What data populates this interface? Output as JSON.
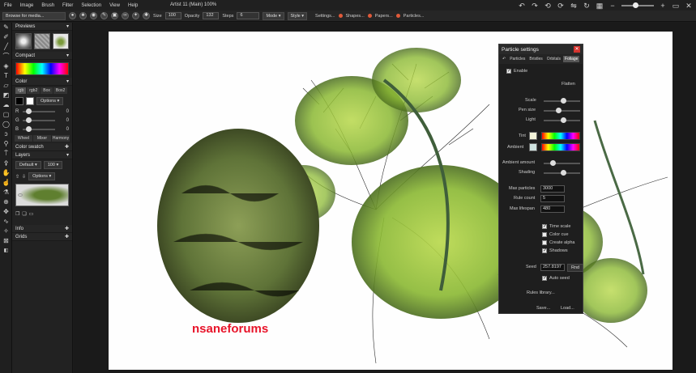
{
  "menu": [
    "File",
    "Image",
    "Brush",
    "Filter",
    "Selection",
    "View",
    "Help"
  ],
  "app_title": "Artist 11 (Main)",
  "zoom": "100%",
  "toolbar": {
    "browse": "Browse for media...",
    "size_label": "Size",
    "size_value": "100",
    "opacity_label": "Opacity",
    "opacity_value": "132",
    "steps_label": "Steps",
    "steps_value": "6",
    "mode_label": "Mode",
    "style_label": "Style",
    "settings_label": "Settings...",
    "shapes_label": "Shapes...",
    "papers_label": "Papers...",
    "particles_label": "Particles..."
  },
  "sidebar": {
    "previews_title": "Previews",
    "compact_title": "Compact",
    "color_title": "Color",
    "color_tabs": [
      "rgb",
      "rgb2",
      "Box",
      "Box2"
    ],
    "options_label": "Options",
    "channels": [
      {
        "label": "R",
        "value": "0"
      },
      {
        "label": "G",
        "value": "0"
      },
      {
        "label": "B",
        "value": "0"
      }
    ],
    "wheel_tabs": [
      "Wheel",
      "Mixer",
      "Harmony"
    ],
    "color_swatch_title": "Color swatch",
    "layers_title": "Layers",
    "layer_blend": "Default",
    "layer_opacity": "100",
    "layers_options": "Options",
    "info_title": "Info",
    "grids_title": "Grids"
  },
  "watermark": "nsaneforums",
  "particle_panel": {
    "title": "Particle settings",
    "tabs": [
      "Particles",
      "Bristles",
      "Orbitals",
      "Foliage"
    ],
    "enable_label": "Enable",
    "flatten_label": "Flatten",
    "scale_label": "Scale",
    "scale_level": 0.55,
    "pen_size_label": "Pen size",
    "pen_size_level": 0.4,
    "light_label": "Light",
    "light_level": 0.55,
    "tint_label": "Tint",
    "ambient_label": "Ambient",
    "ambient_amount_label": "Ambient amount",
    "ambient_amount_level": 0.2,
    "shading_label": "Shading",
    "shading_level": 0.55,
    "max_particles_label": "Max particles",
    "max_particles_value": "3000",
    "rule_count_label": "Rule count",
    "rule_count_value": "5",
    "max_lifespan_label": "Max lifespan",
    "max_lifespan_value": "480",
    "time_scale_label": "Time scale",
    "color_cue_label": "Color cue",
    "create_alpha_label": "Create alpha",
    "shadows_label": "Shadows",
    "seed_label": "Seed",
    "seed_value": "257.8197",
    "rnd_label": "Rnd",
    "auto_seed_label": "Auto seed",
    "rules_library_label": "Rules library...",
    "save_label": "Save...",
    "load_label": "Load..."
  },
  "colors": {
    "accent_red": "#d3342f",
    "foliage_green": "#8ab832",
    "tint_swatch": "#f2f2d8",
    "ambient_swatch": "#cfe3e0"
  }
}
